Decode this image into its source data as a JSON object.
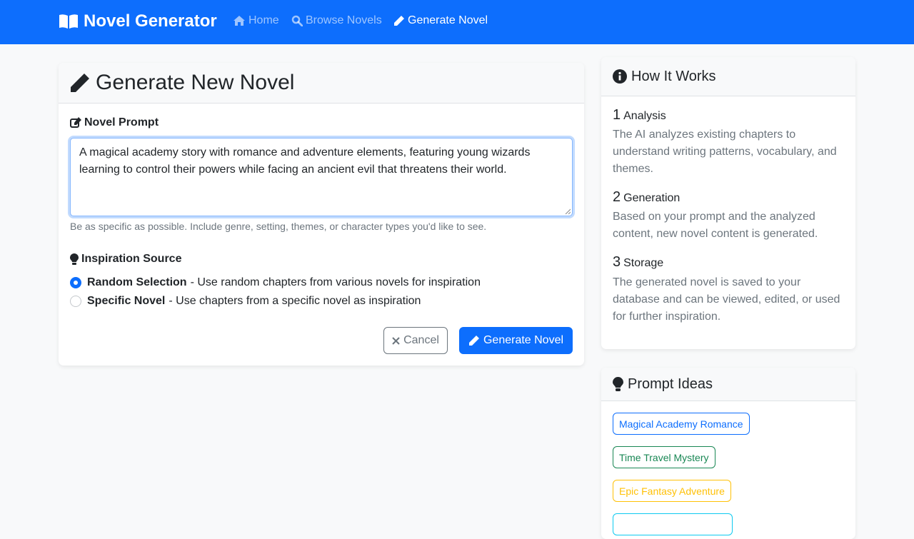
{
  "app": {
    "brand": "Novel Generator",
    "nav": [
      {
        "label": "Home",
        "icon": "home-icon",
        "active": false
      },
      {
        "label": "Browse Novels",
        "icon": "search-icon",
        "active": false
      },
      {
        "label": "Generate Novel",
        "icon": "pencil-icon",
        "active": true
      }
    ]
  },
  "form": {
    "title": "Generate New Novel",
    "prompt_label": "Novel Prompt",
    "prompt_value": "A magical academy story with romance and adventure elements, featuring young wizards learning to control their powers while facing an ancient evil that threatens their world.",
    "prompt_help": "Be as specific as possible. Include genre, setting, themes, or character types you'd like to see.",
    "inspiration_label": "Inspiration Source",
    "options": [
      {
        "label": "Random Selection",
        "description": "- Use random chapters from various novels for inspiration",
        "checked": true
      },
      {
        "label": "Specific Novel",
        "description": "- Use chapters from a specific novel as inspiration",
        "checked": false
      }
    ],
    "cancel_label": "Cancel",
    "generate_label": "Generate Novel"
  },
  "how_it_works": {
    "title": "How It Works",
    "steps": [
      {
        "number": "1",
        "title": "Analysis",
        "text": "The AI analyzes existing chapters to understand writing patterns, vocabulary, and themes."
      },
      {
        "number": "2",
        "title": "Generation",
        "text": "Based on your prompt and the analyzed content, new novel content is generated."
      },
      {
        "number": "3",
        "title": "Storage",
        "text": "The generated novel is saved to your database and can be viewed, edited, or used for further inspiration."
      }
    ]
  },
  "prompt_ideas": {
    "title": "Prompt Ideas",
    "ideas": [
      {
        "label": "Magical Academy Romance",
        "color": "#0d6efd"
      },
      {
        "label": "Time Travel Mystery",
        "color": "#198754"
      },
      {
        "label": "Epic Fantasy Adventure",
        "color": "#ffc107"
      },
      {
        "label": "",
        "color": "#0dcaf0"
      }
    ]
  },
  "colors": {
    "primary": "#0d6efd",
    "secondary": "#6c757d",
    "success": "#198754",
    "warning": "#ffc107",
    "info": "#0dcaf0"
  }
}
